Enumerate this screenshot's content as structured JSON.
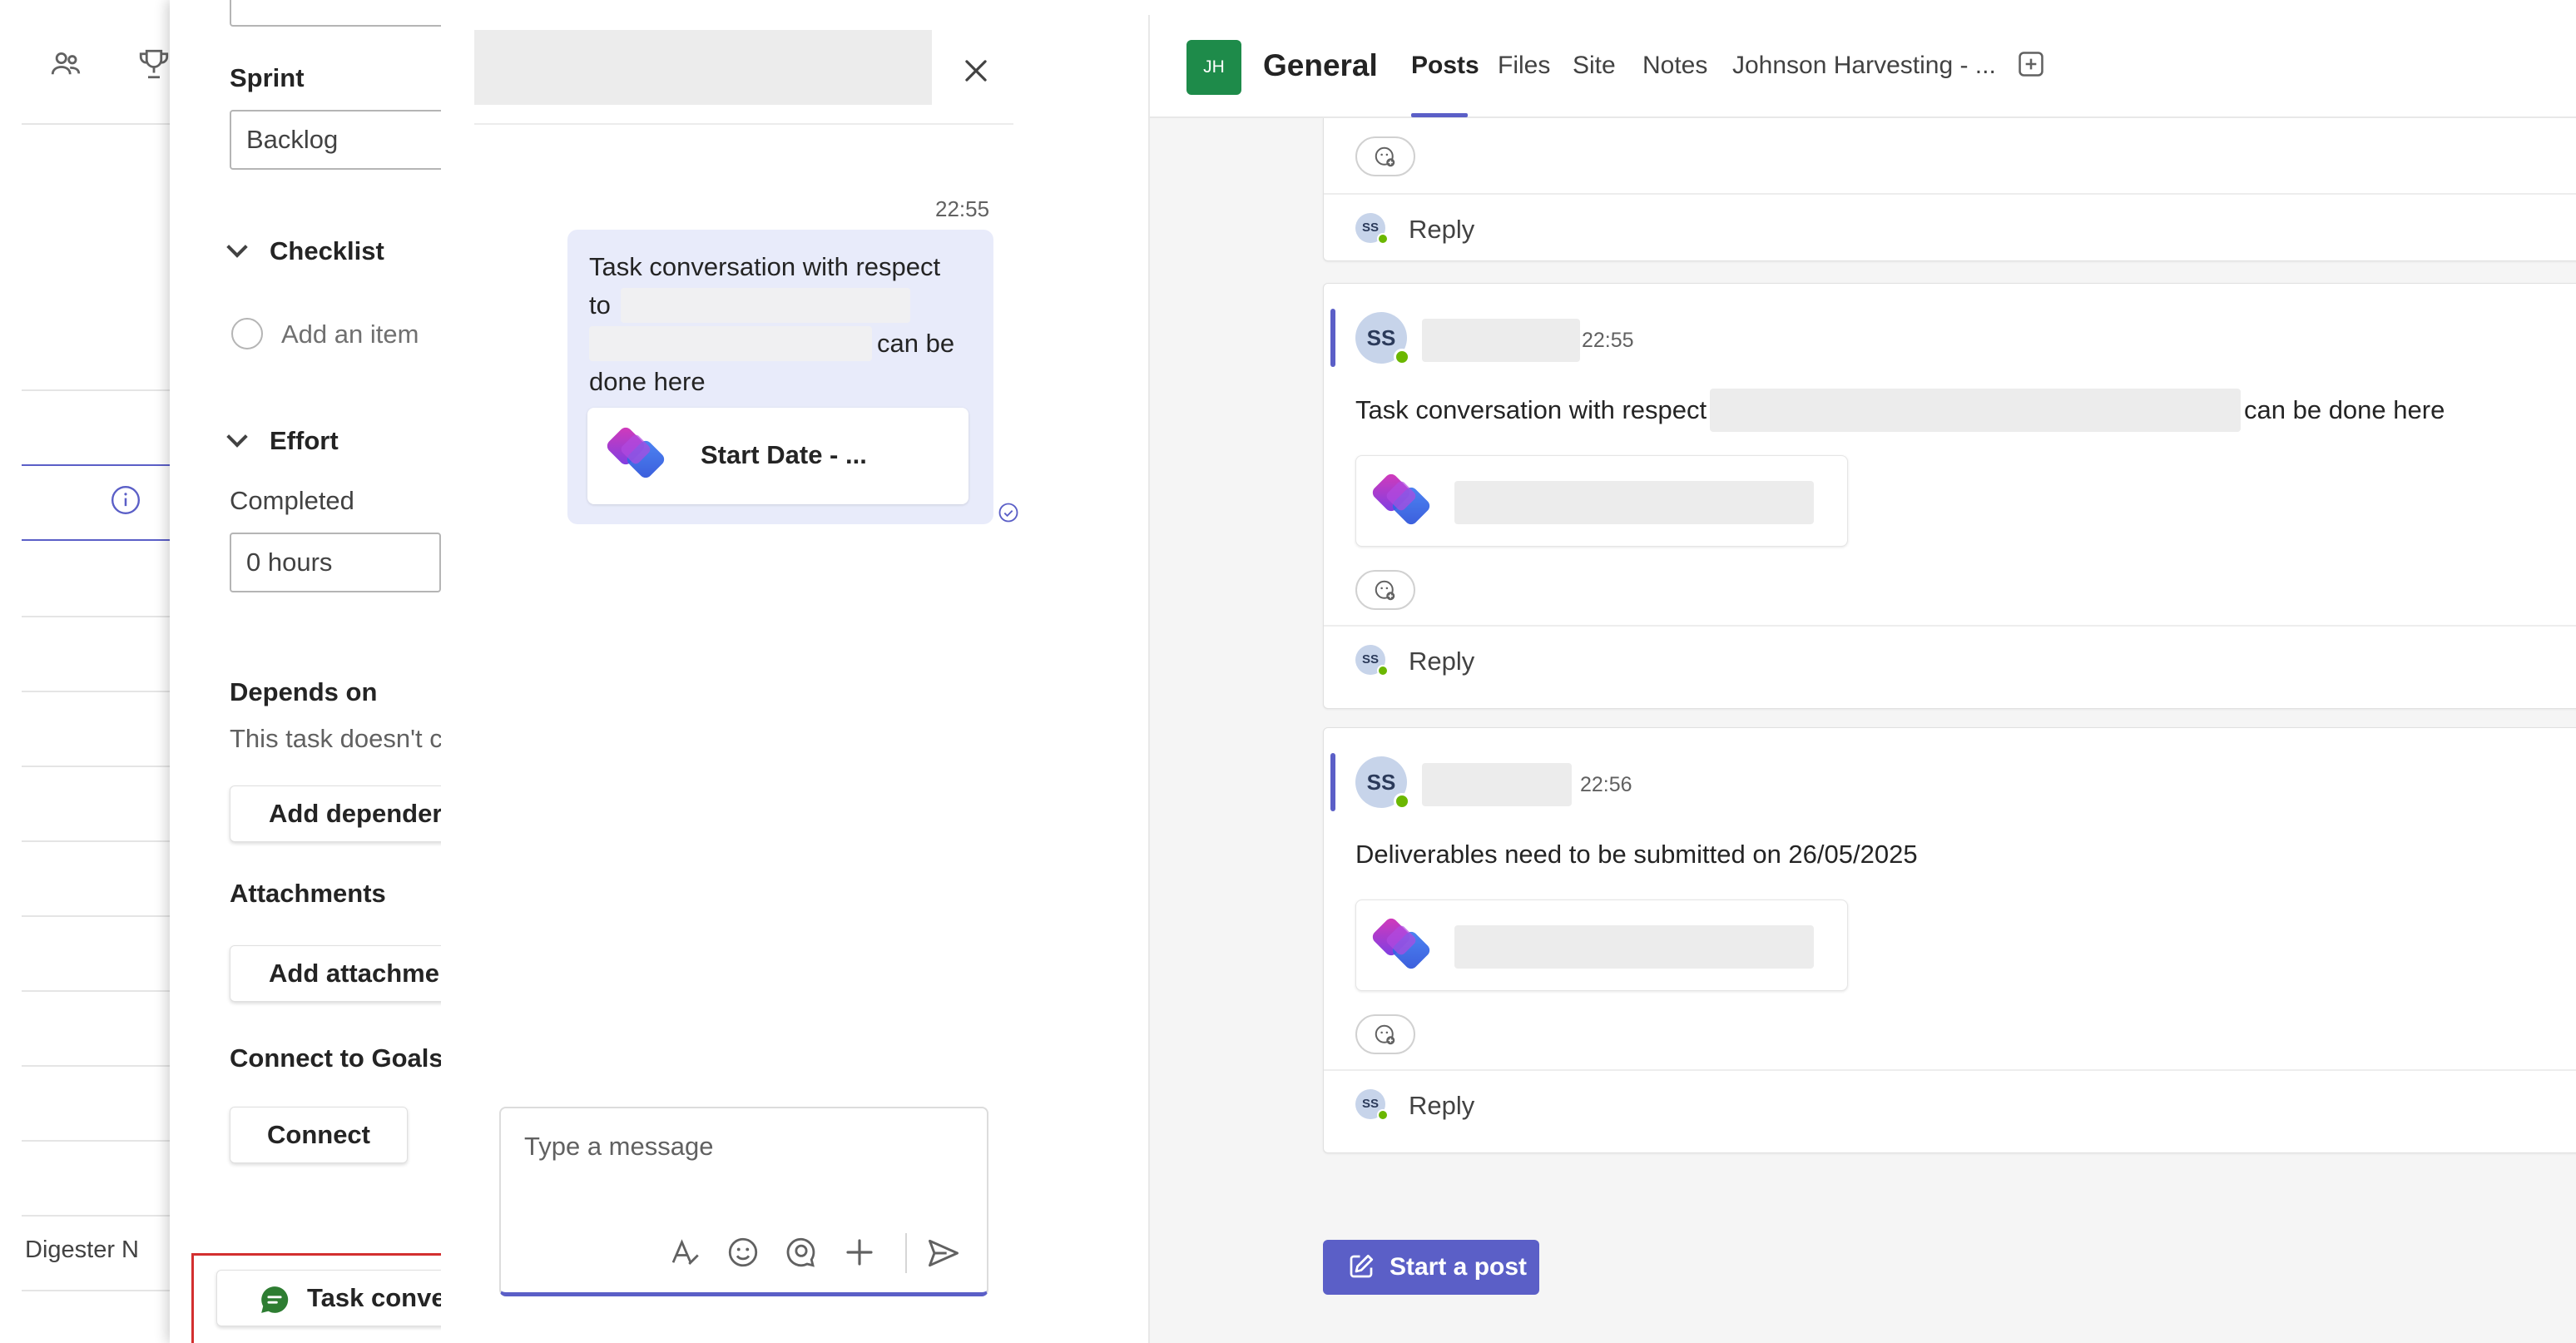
{
  "task_panel": {
    "sprint_label": "Sprint",
    "sprint_value": "Backlog",
    "checklist_label": "Checklist",
    "add_item_placeholder": "Add an item",
    "effort_label": "Effort",
    "completed_label": "Completed",
    "completed_value": "0 hours",
    "depends_label": "Depends on",
    "depends_text": "This task doesn't c",
    "add_dependency_label": "Add depender",
    "attachments_label": "Attachments",
    "add_attachment_label": "Add attachme",
    "goals_label": "Connect to Goals",
    "connect_label": "Connect",
    "task_conversation_label": "Task conve"
  },
  "left_bg": {
    "digester_text": "Digester N"
  },
  "chat": {
    "time": "22:55",
    "bubble_line1": "Task conversation with respect",
    "bubble_line2": "to",
    "bubble_line3": "can be",
    "bubble_line4": "done here",
    "card_title": "Start Date - ...",
    "compose_placeholder": "Type a message"
  },
  "teams": {
    "team_initials": "JH",
    "channel_name": "General",
    "tabs": [
      "Posts",
      "Files",
      "Site",
      "Notes",
      "Johnson Harvesting - ..."
    ],
    "reply_label": "Reply",
    "avatar_initials": "SS",
    "avatar_small": "SS",
    "post1": {
      "time": "22:55",
      "text_before": "Task conversation with respect to",
      "text_after": "can be done here"
    },
    "post2": {
      "time": "22:56",
      "text": "Deliverables need to be submitted on 26/05/2025"
    },
    "start_post_label": "Start a post"
  },
  "colors": {
    "accent": "#5b5fc7",
    "team_tile": "#1e8b4a",
    "bubble": "#e8ebfa",
    "presence": "#6bb700",
    "highlight": "#d32f2f"
  }
}
